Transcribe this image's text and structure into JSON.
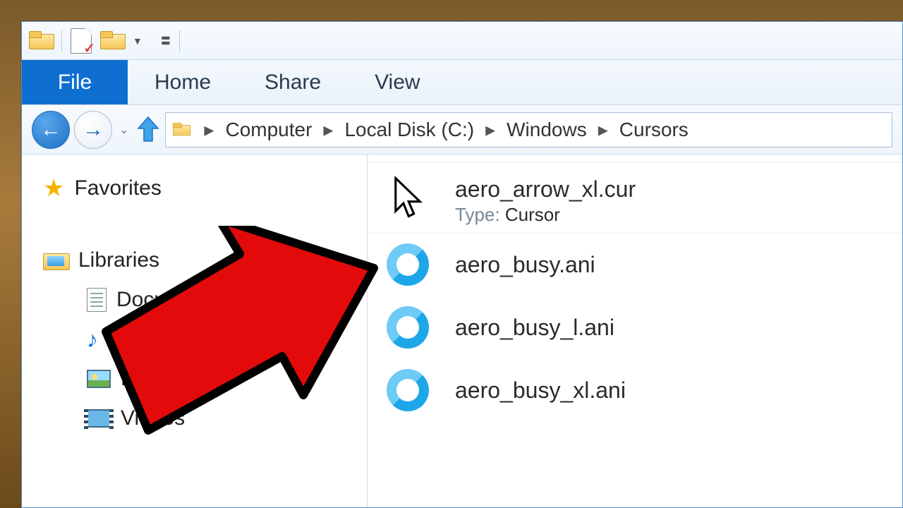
{
  "ribbon": {
    "file": "File",
    "tabs": [
      "Home",
      "Share",
      "View"
    ]
  },
  "breadcrumb": [
    "Computer",
    "Local Disk (C:)",
    "Windows",
    "Cursors"
  ],
  "sidebar": {
    "favorites": "Favorites",
    "libraries": "Libraries",
    "items": [
      {
        "label": "Documents"
      },
      {
        "label": "Music"
      },
      {
        "label": "Pictures"
      },
      {
        "label": "Videos"
      }
    ]
  },
  "files": [
    {
      "name": "aero_arrow_xl.cur",
      "type_label": "Type:",
      "type_value": "Cursor",
      "icon": "cursor"
    },
    {
      "name": "aero_busy.ani",
      "icon": "busy"
    },
    {
      "name": "aero_busy_l.ani",
      "icon": "busy"
    },
    {
      "name": "aero_busy_xl.ani",
      "icon": "busy"
    }
  ],
  "sidebar_truncated": {
    "documents_visible": "Docu",
    "pictures_visible": "Pict"
  }
}
